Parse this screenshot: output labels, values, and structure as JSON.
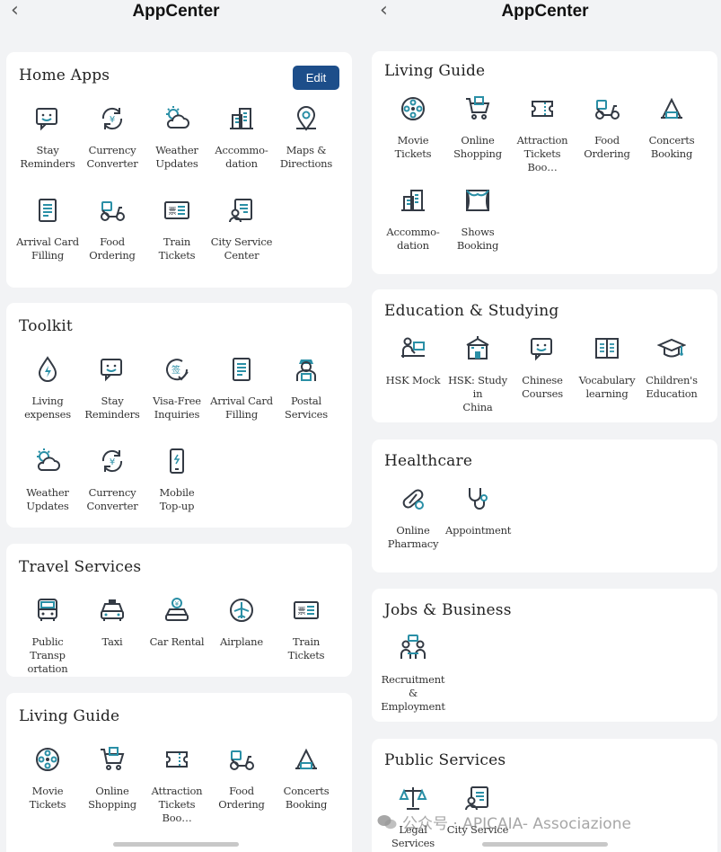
{
  "app_title": "AppCenter",
  "back_symbol": "‹",
  "left": {
    "home_apps": {
      "title": "Home Apps",
      "edit_label": "Edit",
      "items": [
        {
          "label": "Stay\nReminders",
          "icon": "chat-smile-icon"
        },
        {
          "label": "Currency\nConverter",
          "icon": "currency-exchange-icon"
        },
        {
          "label": "Weather\nUpdates",
          "icon": "weather-icon"
        },
        {
          "label": "Accommo-\ndation",
          "icon": "building-icon"
        },
        {
          "label": "Maps &\nDirections",
          "icon": "map-pin-icon"
        },
        {
          "label": "Arrival Card\nFilling",
          "icon": "document-icon"
        },
        {
          "label": "Food Ordering",
          "icon": "scooter-icon"
        },
        {
          "label": "Train Tickets",
          "icon": "ticket-card-icon"
        },
        {
          "label": "City Service\nCenter",
          "icon": "service-doc-icon"
        }
      ]
    },
    "toolkit": {
      "title": "Toolkit",
      "items": [
        {
          "label": "Living\nexpenses",
          "icon": "utility-drop-icon"
        },
        {
          "label": "Stay\nReminders",
          "icon": "chat-smile-icon"
        },
        {
          "label": "Visa-Free\nInquiries",
          "icon": "visa-check-icon"
        },
        {
          "label": "Arrival Card\nFilling",
          "icon": "document-icon"
        },
        {
          "label": "Postal\nServices",
          "icon": "postman-icon"
        },
        {
          "label": "Weather\nUpdates",
          "icon": "weather-icon"
        },
        {
          "label": "Currency\nConverter",
          "icon": "currency-exchange-icon"
        },
        {
          "label": "Mobile\nTop-up",
          "icon": "mobile-phone-icon"
        }
      ]
    },
    "travel": {
      "title": "Travel Services",
      "items": [
        {
          "label": "Public Transp\nortation",
          "icon": "bus-icon"
        },
        {
          "label": "Taxi",
          "icon": "taxi-icon"
        },
        {
          "label": "Car Rental",
          "icon": "car-rental-icon"
        },
        {
          "label": "Airplane",
          "icon": "airplane-icon"
        },
        {
          "label": "Train Tickets",
          "icon": "ticket-card-icon"
        }
      ]
    },
    "living_guide": {
      "title": "Living Guide",
      "items": [
        {
          "label": "Movie Tickets",
          "icon": "film-reel-icon"
        },
        {
          "label": "Online\nShopping",
          "icon": "shopping-cart-icon"
        },
        {
          "label": "Attraction\nTickets Boo…",
          "icon": "ticket-icon"
        },
        {
          "label": "Food Ordering",
          "icon": "scooter-icon"
        },
        {
          "label": "Concerts\nBooking",
          "icon": "concert-hall-icon"
        }
      ]
    }
  },
  "right": {
    "living_guide": {
      "title": "Living Guide",
      "items": [
        {
          "label": "Movie Tickets",
          "icon": "film-reel-icon"
        },
        {
          "label": "Online\nShopping",
          "icon": "shopping-cart-icon"
        },
        {
          "label": "Attraction\nTickets Boo…",
          "icon": "ticket-icon"
        },
        {
          "label": "Food Ordering",
          "icon": "scooter-icon"
        },
        {
          "label": "Concerts\nBooking",
          "icon": "concert-hall-icon"
        },
        {
          "label": "Accommo-\ndation",
          "icon": "building-icon"
        },
        {
          "label": "Shows\nBooking",
          "icon": "stage-curtain-icon"
        }
      ]
    },
    "education": {
      "title": "Education & Studying",
      "items": [
        {
          "label": "HSK Mock",
          "icon": "student-desk-icon"
        },
        {
          "label": "HSK: Study in\nChina",
          "icon": "school-building-icon"
        },
        {
          "label": "Chinese\nCourses",
          "icon": "chat-smile-icon"
        },
        {
          "label": "Vocabulary\nlearning",
          "icon": "open-book-icon"
        },
        {
          "label": "Children's\nEducation",
          "icon": "graduation-cap-icon"
        }
      ]
    },
    "healthcare": {
      "title": "Healthcare",
      "items": [
        {
          "label": "Online\nPharmacy",
          "icon": "pill-icon"
        },
        {
          "label": "Appointment",
          "icon": "stethoscope-icon"
        }
      ]
    },
    "jobs": {
      "title": "Jobs & Business",
      "items": [
        {
          "label": "Recruitment &\nEmployment",
          "icon": "interview-icon"
        }
      ]
    },
    "public": {
      "title": "Public Services",
      "items": [
        {
          "label": "Legal Services",
          "icon": "scales-icon"
        },
        {
          "label": "City Service",
          "icon": "service-doc-icon"
        }
      ]
    }
  },
  "watermark": "公众号 · APICAIA- Associazione",
  "colors": {
    "accent": "#1d4e8a",
    "icon_dark": "#333a44",
    "icon_teal": "#2a8fa6"
  }
}
